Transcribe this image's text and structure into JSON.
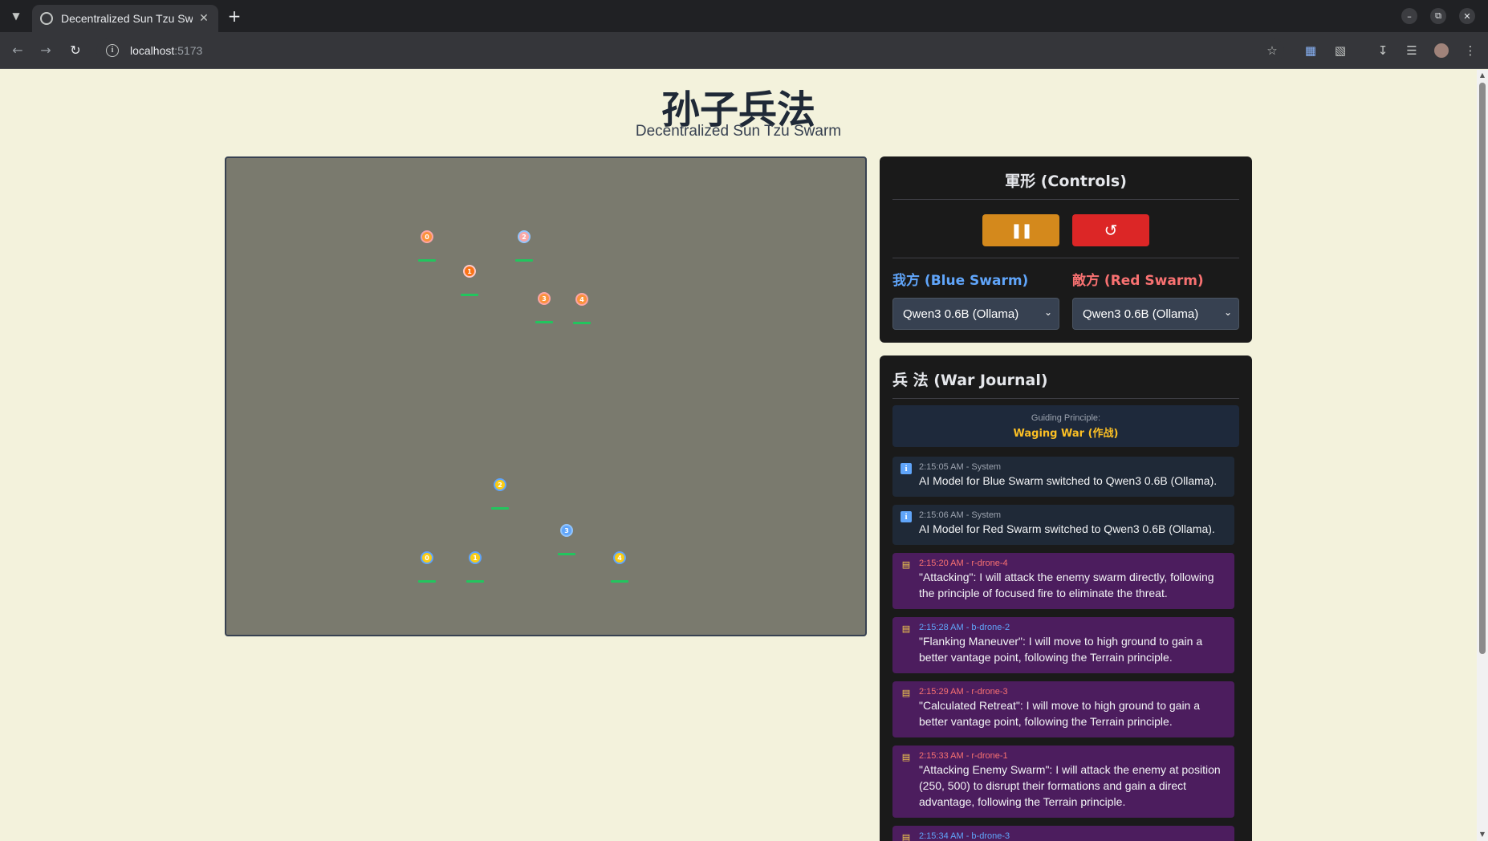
{
  "browser": {
    "tab_title": "Decentralized Sun Tzu Sw",
    "url_host": "localhost",
    "url_port": ":5173"
  },
  "header": {
    "title": "孙子兵法",
    "subtitle": "Decentralized Sun Tzu Swarm"
  },
  "battlefield": {
    "red_drones": [
      {
        "label": "0"
      },
      {
        "label": "2"
      },
      {
        "label": "1"
      },
      {
        "label": "3"
      },
      {
        "label": "4"
      }
    ],
    "blue_drones": [
      {
        "label": "2"
      },
      {
        "label": "3"
      },
      {
        "label": "0"
      },
      {
        "label": "1"
      },
      {
        "label": "4"
      }
    ]
  },
  "controls": {
    "title": "軍形 (Controls)",
    "pause_icon": "pause-icon",
    "reset_icon": "reset-icon",
    "blue_label": "我方 (Blue Swarm)",
    "red_label": "敵方 (Red Swarm)",
    "blue_model": "Qwen3 0.6B (Ollama)",
    "red_model": "Qwen3 0.6B (Ollama)"
  },
  "journal": {
    "title": "兵 法 (War Journal)",
    "principle_label": "Guiding Principle:",
    "principle_value": "Waging War (作战)",
    "entries": [
      {
        "meta": "2:15:05 AM - System",
        "msg": "AI Model for Blue Swarm switched to Qwen3 0.6B (Ollama)."
      },
      {
        "meta": "2:15:06 AM - System",
        "msg": "AI Model for Red Swarm switched to Qwen3 0.6B (Ollama)."
      },
      {
        "meta": "2:15:20 AM - r-drone-4",
        "msg": "\"Attacking\": I will attack the enemy swarm directly, following the principle of focused fire to eliminate the threat."
      },
      {
        "meta": "2:15:28 AM - b-drone-2",
        "msg": "\"Flanking Maneuver\": I will move to high ground to gain a better vantage point, following the Terrain principle."
      },
      {
        "meta": "2:15:29 AM - r-drone-3",
        "msg": "\"Calculated Retreat\": I will move to high ground to gain a better vantage point, following the Terrain principle."
      },
      {
        "meta": "2:15:33 AM - r-drone-1",
        "msg": "\"Attacking Enemy Swarm\": I will attack the enemy at position (250, 500) to disrupt their formations and gain a direct advantage, following the Terrain principle."
      },
      {
        "meta": "2:15:34 AM - b-drone-3",
        "msg": ""
      }
    ]
  }
}
